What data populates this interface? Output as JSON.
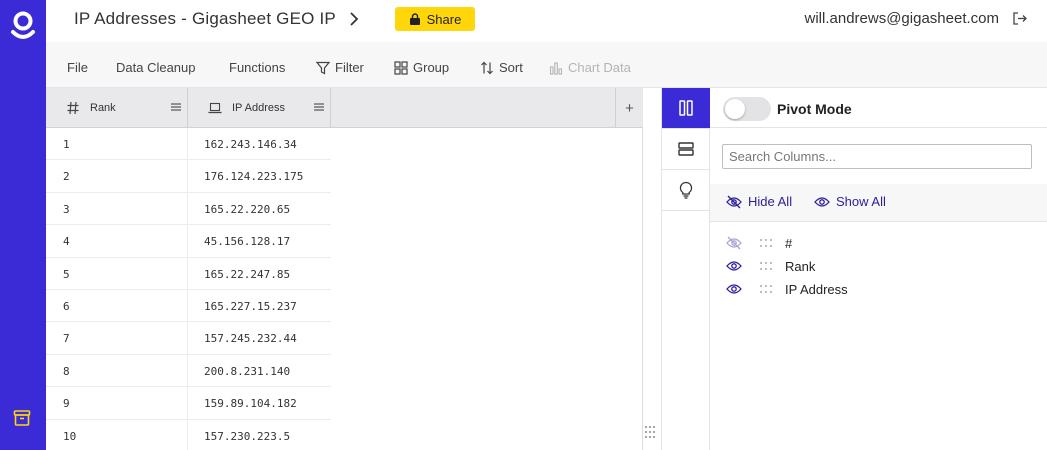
{
  "app": {
    "title": "IP Addresses - Gigasheet GEO IP",
    "share_label": "Share",
    "user_email": "will.andrews@gigasheet.com"
  },
  "toolbar": {
    "file": "File",
    "data_cleanup": "Data Cleanup",
    "functions": "Functions",
    "filter": "Filter",
    "group": "Group",
    "sort": "Sort",
    "chart_data": "Chart Data"
  },
  "grid": {
    "columns": [
      "Rank",
      "IP Address"
    ],
    "add_column": "+",
    "rows": [
      [
        "1",
        "162.243.146.34"
      ],
      [
        "2",
        "176.124.223.175"
      ],
      [
        "3",
        "165.22.220.65"
      ],
      [
        "4",
        "45.156.128.17"
      ],
      [
        "5",
        "165.22.247.85"
      ],
      [
        "6",
        "165.227.15.237"
      ],
      [
        "7",
        "157.245.232.44"
      ],
      [
        "8",
        "200.8.231.140"
      ],
      [
        "9",
        "159.89.104.182"
      ],
      [
        "10",
        "157.230.223.5"
      ]
    ]
  },
  "panel": {
    "pivot_mode": "Pivot Mode",
    "pivot_enabled": false,
    "search_placeholder": "Search Columns...",
    "hide_all": "Hide All",
    "show_all": "Show All",
    "columns": [
      {
        "name": "#",
        "visible": false
      },
      {
        "name": "Rank",
        "visible": true
      },
      {
        "name": "IP Address",
        "visible": true
      }
    ]
  },
  "colors": {
    "brand": "#3b2bd6",
    "share": "#ffd60a",
    "link": "#2b1e9a"
  }
}
